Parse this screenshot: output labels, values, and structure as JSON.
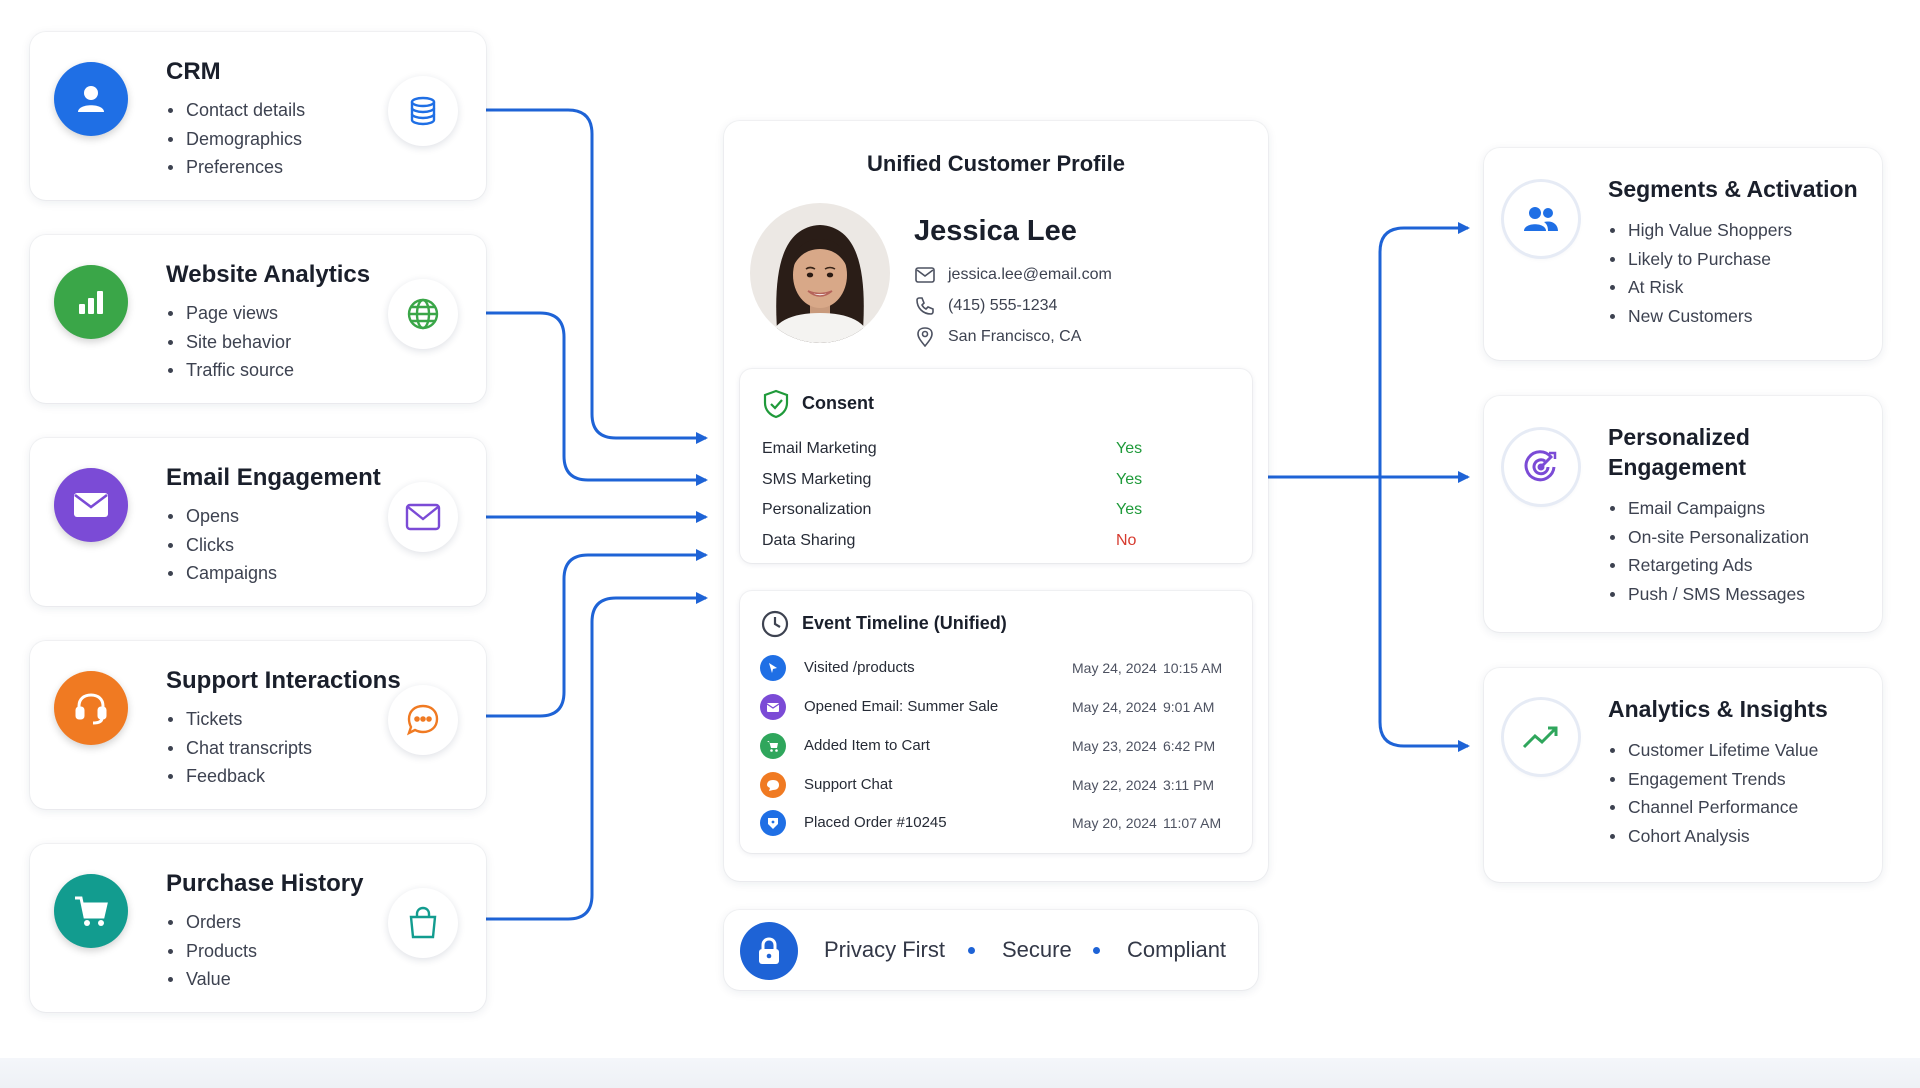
{
  "sources": [
    {
      "title": "CRM",
      "items": [
        "Contact details",
        "Demographics",
        "Preferences"
      ],
      "icon": "person-icon",
      "small_icon": "database-icon",
      "color": "#1f6fe5"
    },
    {
      "title": "Website Analytics",
      "items": [
        "Page views",
        "Site behavior",
        "Traffic source"
      ],
      "icon": "bar-chart-icon",
      "small_icon": "globe-icon",
      "color": "#3aa648"
    },
    {
      "title": "Email Engagement",
      "items": [
        "Opens",
        "Clicks",
        "Campaigns"
      ],
      "icon": "envelope-icon",
      "small_icon": "envelope-icon",
      "color": "#7b4bd6"
    },
    {
      "title": "Support Interactions",
      "items": [
        "Tickets",
        "Chat transcripts",
        "Feedback"
      ],
      "icon": "headset-icon",
      "small_icon": "chat-bubble-icon",
      "color": "#f07a22"
    },
    {
      "title": "Purchase History",
      "items": [
        "Orders",
        "Products",
        "Value"
      ],
      "icon": "shopping-cart-icon",
      "small_icon": "shopping-bag-icon",
      "color": "#129c8f"
    }
  ],
  "profile": {
    "title": "Unified Customer Profile",
    "name": "Jessica Lee",
    "email": "jessica.lee@email.com",
    "phone": "(415) 555-1234",
    "location": "San Francisco, CA"
  },
  "consent": {
    "title": "Consent",
    "rows": [
      {
        "label": "Email Marketing",
        "value": "Yes",
        "color": "#1f9a3a"
      },
      {
        "label": "SMS Marketing",
        "value": "Yes",
        "color": "#1f9a3a"
      },
      {
        "label": "Personalization",
        "value": "Yes",
        "color": "#1f9a3a"
      },
      {
        "label": "Data Sharing",
        "value": "No",
        "color": "#d63a2e"
      }
    ]
  },
  "timeline": {
    "title": "Event Timeline (Unified)",
    "events": [
      {
        "label": "Visited /products",
        "date": "May 24, 2024",
        "time": "10:15 AM",
        "color": "#1f6fe5",
        "icon": "cursor-icon"
      },
      {
        "label": "Opened Email: Summer Sale",
        "date": "May 24, 2024",
        "time": "9:01 AM",
        "color": "#7b4bd6",
        "icon": "envelope-icon"
      },
      {
        "label": "Added Item to Cart",
        "date": "May 23, 2024",
        "time": "6:42 PM",
        "color": "#2fa65c",
        "icon": "cart-icon"
      },
      {
        "label": "Support Chat",
        "date": "May 22, 2024",
        "time": "3:11 PM",
        "color": "#f07a22",
        "icon": "chat-icon"
      },
      {
        "label": "Placed Order #10245",
        "date": "May 20, 2024",
        "time": "11:07 AM",
        "color": "#1f6fe5",
        "icon": "tag-icon"
      }
    ]
  },
  "privacy": {
    "items": [
      "Privacy First",
      "Secure",
      "Compliant"
    ]
  },
  "outputs": [
    {
      "title_lines": [
        "Segments & Activation"
      ],
      "items": [
        "High Value Shoppers",
        "Likely to Purchase",
        "At Risk",
        "New Customers"
      ],
      "icon": "users-icon",
      "color": "#1f6fe5"
    },
    {
      "title_lines": [
        "Personalized",
        "Engagement"
      ],
      "items": [
        "Email Campaigns",
        "On-site Personalization",
        "Retargeting Ads",
        "Push / SMS Messages"
      ],
      "icon": "target-icon",
      "color": "#7b4bd6"
    },
    {
      "title_lines": [
        "Analytics & Insights"
      ],
      "items": [
        "Customer Lifetime Value",
        "Engagement Trends",
        "Channel Performance",
        "Cohort Analysis"
      ],
      "icon": "trend-up-icon",
      "color": "#2fa65c"
    }
  ],
  "colors": {
    "connector": "#1e63d6"
  }
}
